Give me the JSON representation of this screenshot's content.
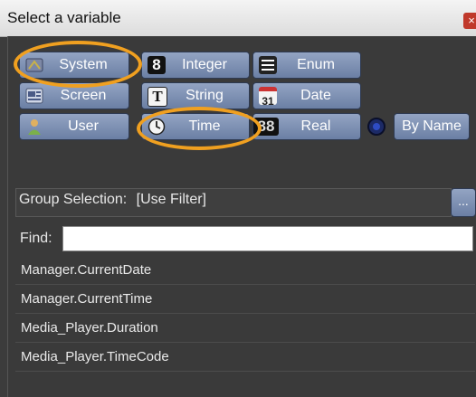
{
  "window": {
    "title": "Select a variable",
    "close_glyph": "×"
  },
  "type_buttons": [
    {
      "label": "System",
      "icon": "system-icon",
      "selected": true
    },
    {
      "label": "Integer",
      "icon": "integer-icon",
      "selected": false
    },
    {
      "label": "Enum",
      "icon": "enum-icon",
      "selected": false
    },
    {
      "label": "Screen",
      "icon": "screen-icon",
      "selected": false
    },
    {
      "label": "String",
      "icon": "string-icon",
      "selected": false
    },
    {
      "label": "Date",
      "icon": "calendar-icon",
      "selected": false
    },
    {
      "label": "User",
      "icon": "user-icon",
      "selected": false
    },
    {
      "label": "Time",
      "icon": "clock-icon",
      "selected": true
    },
    {
      "label": "Real",
      "icon": "real-icon",
      "selected": false
    }
  ],
  "by_name": {
    "label": "By Name",
    "icon": "sort-icon"
  },
  "group_selection": {
    "label": "Group Selection:",
    "value": "[Use Filter]",
    "browse_label": "..."
  },
  "find": {
    "label": "Find:",
    "value": ""
  },
  "results": [
    "Manager.CurrentDate",
    "Manager.CurrentTime",
    "Media_Player.Duration",
    "Media_Player.TimeCode"
  ],
  "icon_glyphs": {
    "integer": "8",
    "string": "T",
    "date": "31",
    "real": "88"
  },
  "colors": {
    "highlight_ring": "#f0a020",
    "button_gradient_top": "#93a4c3",
    "button_gradient_bottom": "#6b7fa4",
    "panel_bg": "#3a3a3a"
  }
}
